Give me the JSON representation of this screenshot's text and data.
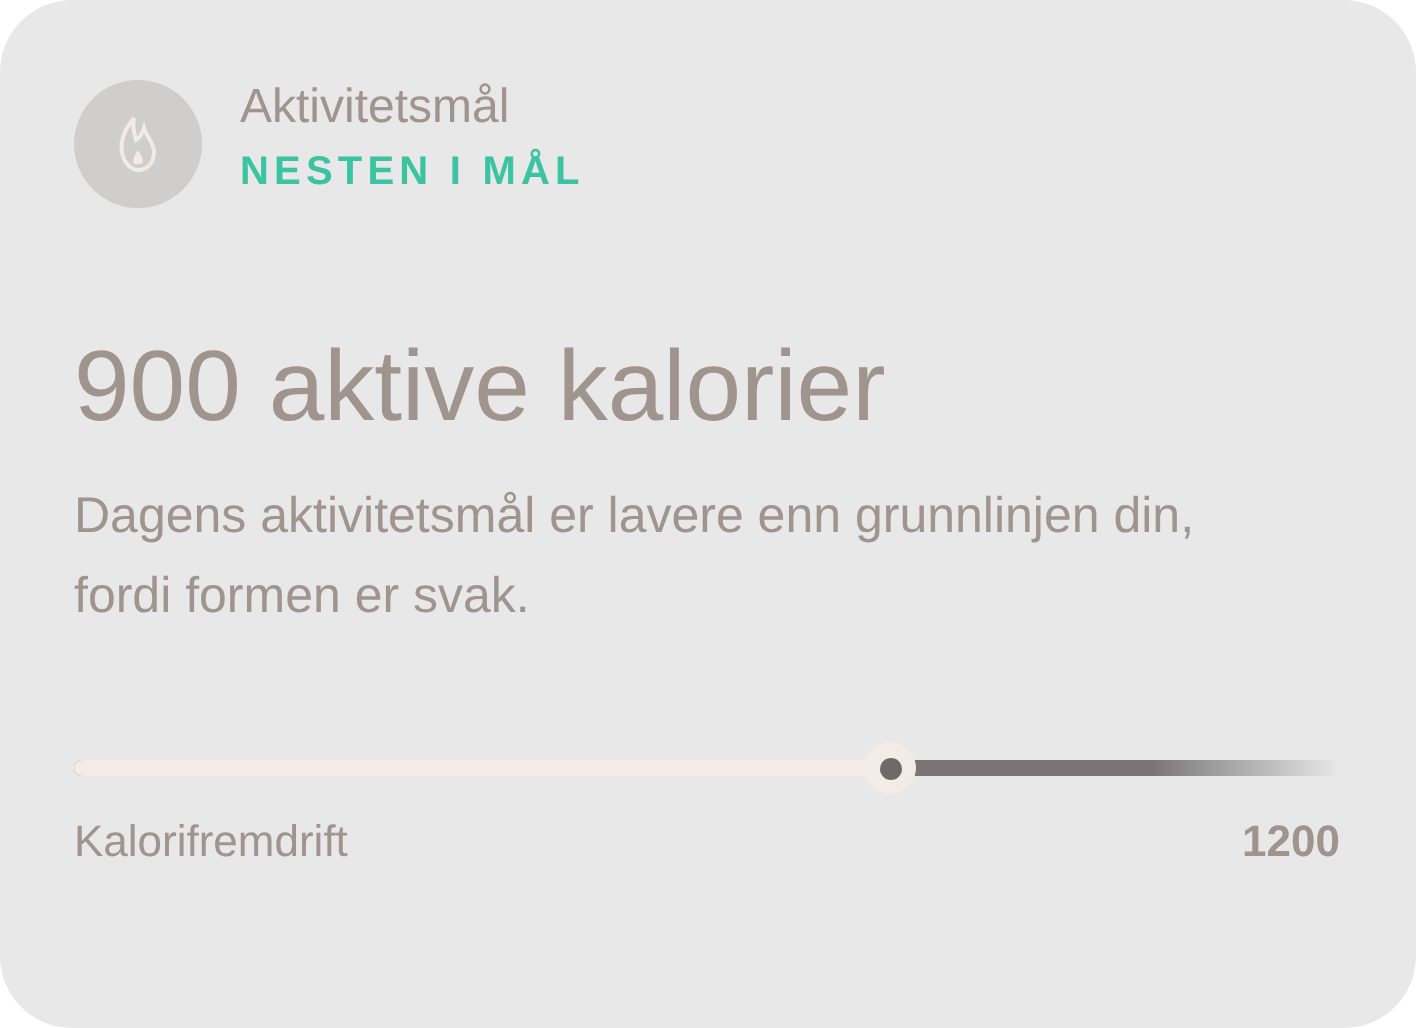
{
  "header": {
    "title": "Aktivitetsmål",
    "status": "NESTEN I MÅL"
  },
  "headline": "900 aktive kalorier",
  "description": "Dagens aktivitetsmål er lavere enn grunnlinjen din, fordi formen er svak.",
  "progress": {
    "level": 0.645,
    "label": "Kalorifremdrift",
    "goal": "1200"
  }
}
